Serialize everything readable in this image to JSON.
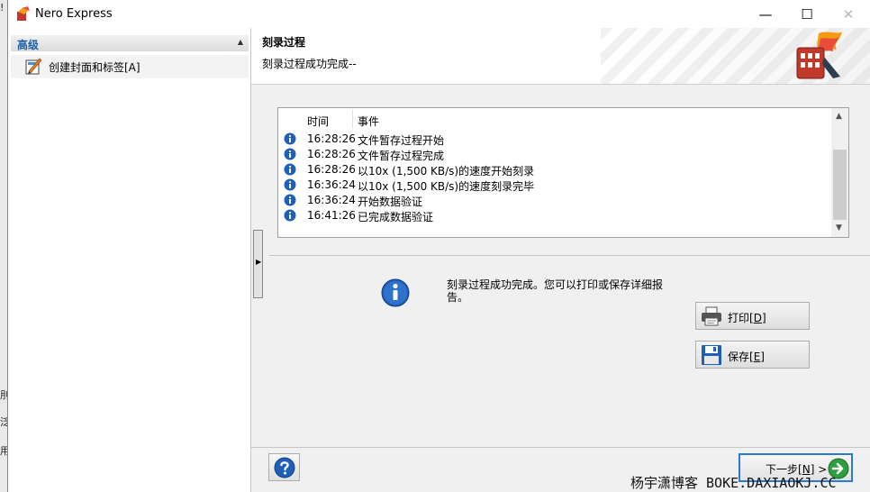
{
  "window": {
    "title": "Nero Express",
    "controls": {
      "minimize": "—",
      "maximize": "☐",
      "close": "✕"
    }
  },
  "desktop_fragments": [
    "!",
    "刖",
    "泛",
    "用"
  ],
  "sidebar": {
    "section_title": "高级",
    "collapse_glyph": "▲",
    "items": [
      {
        "label": "创建封面和标签[A]",
        "icon": "cover-label-icon"
      }
    ]
  },
  "header": {
    "title": "刻录过程",
    "subtitle": "刻录过程成功完成--"
  },
  "splitter": {
    "glyph": "▶"
  },
  "log": {
    "columns": {
      "time": "时间",
      "event": "事件"
    },
    "rows": [
      {
        "time": "16:28:26",
        "event": "文件暂存过程开始"
      },
      {
        "time": "16:28:26",
        "event": "文件暂存过程完成"
      },
      {
        "time": "16:28:26",
        "event": "以10x (1,500 KB/s)的速度开始刻录"
      },
      {
        "time": "16:36:24",
        "event": "以10x (1,500 KB/s)的速度刻录完毕"
      },
      {
        "time": "16:36:24",
        "event": "开始数据验证"
      },
      {
        "time": "16:41:26",
        "event": "已完成数据验证"
      }
    ],
    "scroll_up": "▲",
    "scroll_down": "▼"
  },
  "message": "刻录过程成功完成。您可以打印或保存详细报告。",
  "buttons": {
    "print": {
      "label": "打印",
      "key": "D"
    },
    "save": {
      "label": "保存",
      "key": "E"
    },
    "next": {
      "label": "下一步",
      "key": "N",
      "suffix": " >"
    }
  },
  "watermark": "杨宇潇博客 BOKE.DAXIAOKJ.CC",
  "colors": {
    "accent": "#2a7bd0",
    "section_title": "#1c5ea8",
    "info_blue": "#1f5fb8"
  }
}
